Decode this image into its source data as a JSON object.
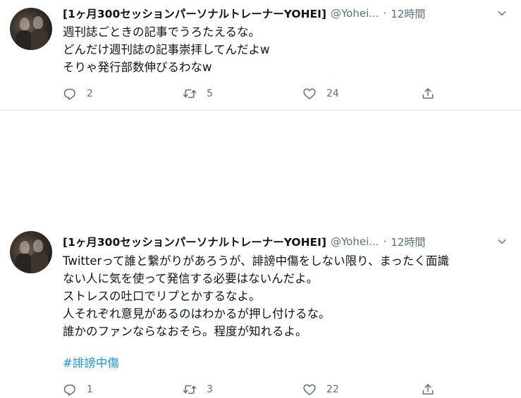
{
  "tweets": [
    {
      "name": "[1ヶ月300セッションパーソナルトレーナーYOHEI]",
      "handle": "@Yohei...",
      "separator": "·",
      "time": "12時間",
      "lines": [
        "週刊誌ごときの記事でうろたえるな。",
        "どんだけ週刊誌の記事崇拝してんだよw",
        "そりゃ発行部数伸びるわなw"
      ],
      "hashtag": "",
      "reply_count": "2",
      "retweet_count": "5",
      "like_count": "24"
    },
    {
      "name": "[1ヶ月300セッションパーソナルトレーナーYOHEI]",
      "handle": "@Yohei...",
      "separator": "·",
      "time": "12時間",
      "lines": [
        "Twitterって誰と繋がりがあろうが、誹謗中傷をしない限り、まったく面識",
        "ない人に気を使って発信する必要はないんだよ。",
        "ストレスの吐口でリプとかするなよ。",
        "人それぞれ意見があるのはわかるが押し付けるな。",
        "誰かのファンならなおそら。程度が知れるよ。"
      ],
      "hashtag": "#誹謗中傷",
      "reply_count": "1",
      "retweet_count": "3",
      "like_count": "22"
    }
  ],
  "colors": {
    "text": "#0f1419",
    "secondary": "#5b7083",
    "link": "#1b95e0",
    "divider": "#e6ecf0"
  },
  "icons": [
    "reply-icon",
    "retweet-icon",
    "like-icon",
    "share-icon",
    "chevron-down-icon"
  ]
}
